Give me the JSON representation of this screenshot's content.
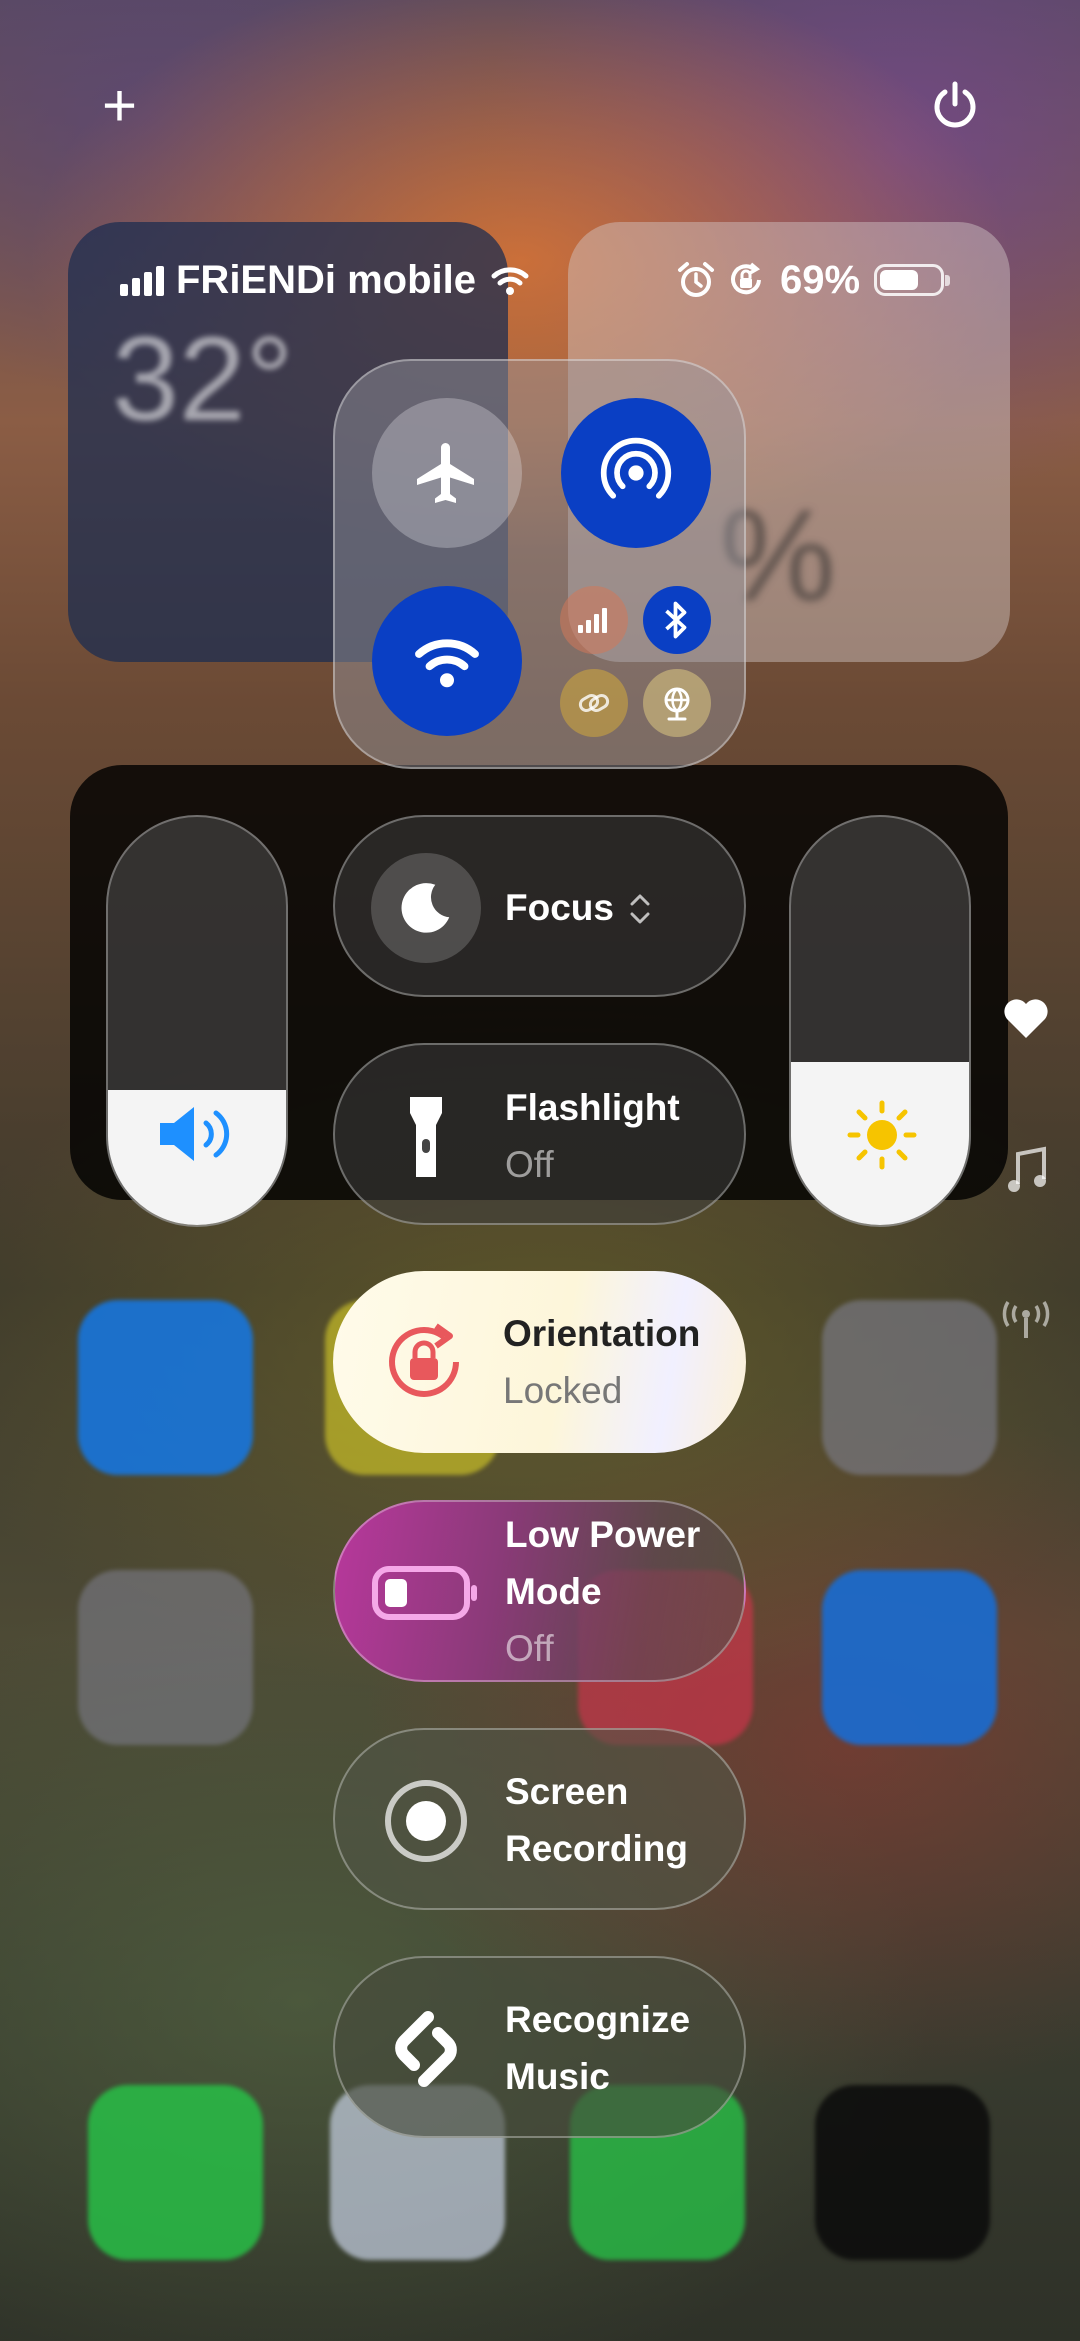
{
  "top_controls": {
    "add_symbol": "+"
  },
  "status_bar": {
    "carrier": "FRiENDi mobile",
    "battery_percent": "69%"
  },
  "background_widgets": {
    "weather_temp": "32°",
    "battery_widget_text": "%"
  },
  "connectivity": {
    "airplane_mode": "off",
    "airdrop": "on",
    "wifi": "on",
    "cellular": "off",
    "bluetooth": "on",
    "vpn": "off",
    "satellite": "off"
  },
  "controls": {
    "focus": {
      "label": "Focus"
    },
    "flashlight": {
      "label": "Flashlight",
      "state": "Off"
    },
    "orientation": {
      "label": "Orientation",
      "state": "Locked"
    },
    "low_power": {
      "label_line1": "Low Power",
      "label_line2": "Mode",
      "state": "Off"
    },
    "screen_recording": {
      "label_line1": "Screen",
      "label_line2": "Recording"
    },
    "recognize_music": {
      "label_line1": "Recognize",
      "label_line2": "Music"
    }
  },
  "sliders": {
    "volume_level": 0.33,
    "brightness_level": 0.4
  },
  "colors": {
    "accent_blue": "#0a3fc4",
    "volume_icon": "#1e90ff",
    "brightness_icon": "#f6c400",
    "lock_red": "#e8585c"
  }
}
